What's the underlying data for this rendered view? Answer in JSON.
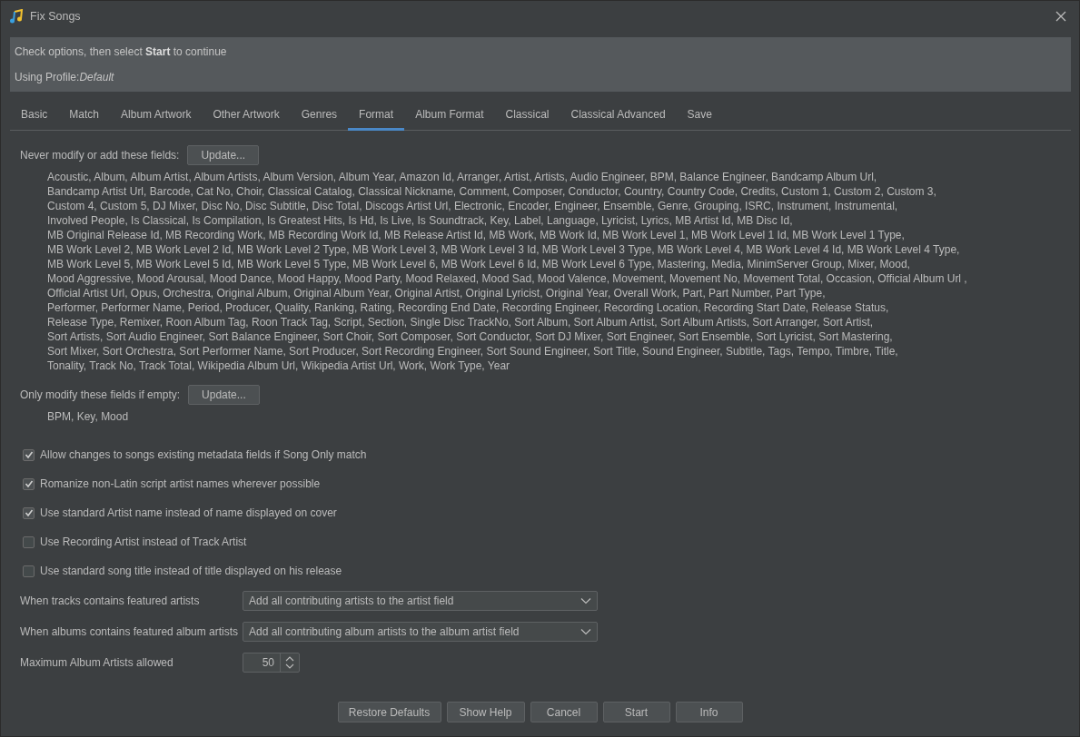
{
  "window": {
    "title": "Fix Songs"
  },
  "header": {
    "instruction": "Check options, then select **Start** to continue",
    "profile_label": "Using Profile:",
    "profile_name": "Default"
  },
  "tabs": [
    {
      "label": "Basic",
      "selected": false
    },
    {
      "label": "Match",
      "selected": false
    },
    {
      "label": "Album Artwork",
      "selected": false
    },
    {
      "label": "Other Artwork",
      "selected": false
    },
    {
      "label": "Genres",
      "selected": false
    },
    {
      "label": "Format",
      "selected": true
    },
    {
      "label": "Album Format",
      "selected": false
    },
    {
      "label": "Classical",
      "selected": false
    },
    {
      "label": "Classical Advanced",
      "selected": false
    },
    {
      "label": "Save",
      "selected": false
    }
  ],
  "never_modify": {
    "label": "Never modify or add these fields:",
    "button": "Update...",
    "lines": [
      "Acoustic, Album, Album Artist, Album Artists, Album Version, Album Year, Amazon Id, Arranger, Artist, Artists, Audio Engineer, BPM, Balance Engineer, Bandcamp Album Url,",
      "Bandcamp Artist Url, Barcode, Cat No, Choir, Classical Catalog, Classical Nickname, Comment, Composer, Conductor, Country, Country Code, Credits, Custom 1, Custom 2, Custom 3,",
      "Custom 4, Custom 5, DJ Mixer, Disc No, Disc Subtitle, Disc Total, Discogs Artist Url, Electronic, Encoder, Engineer, Ensemble, Genre, Grouping, ISRC, Instrument, Instrumental,",
      "Involved People, Is Classical, Is Compilation, Is Greatest Hits, Is Hd, Is Live, Is Soundtrack, Key, Label, Language, Lyricist, Lyrics, MB Artist Id, MB Disc Id,",
      "MB Original Release Id, MB Recording Work, MB Recording Work Id, MB Release Artist Id, MB Work, MB Work Id, MB Work Level 1, MB Work Level 1 Id, MB Work Level 1 Type,",
      "MB Work Level 2, MB Work Level 2 Id, MB Work Level 2 Type, MB Work Level 3, MB Work Level 3 Id, MB Work Level 3 Type, MB Work Level 4, MB Work Level 4 Id, MB Work Level 4 Type,",
      "MB Work Level 5, MB Work Level 5 Id, MB Work Level 5 Type, MB Work Level 6, MB Work Level 6 Id, MB Work Level 6 Type, Mastering, Media, MinimServer Group, Mixer, Mood,",
      "Mood Aggressive, Mood Arousal, Mood Dance, Mood Happy, Mood Party, Mood Relaxed, Mood Sad, Mood Valence, Movement, Movement No, Movement Total, Occasion, Official Album Url ,",
      "Official Artist Url, Opus, Orchestra, Original Album, Original Album Year, Original Artist, Original Lyricist, Original Year, Overall Work, Part, Part Number, Part Type,",
      "Performer, Performer Name, Period, Producer, Quality, Ranking, Rating, Recording End Date, Recording Engineer, Recording Location, Recording Start Date, Release Status,",
      "Release Type, Remixer, Roon Album Tag, Roon Track Tag, Script, Section, Single Disc TrackNo, Sort Album, Sort Album Artist, Sort Album Artists, Sort Arranger, Sort Artist,",
      "Sort Artists, Sort Audio Engineer, Sort Balance Engineer, Sort Choir, Sort Composer, Sort Conductor, Sort DJ Mixer, Sort Engineer, Sort Ensemble, Sort Lyricist, Sort Mastering,",
      "Sort Mixer, Sort Orchestra, Sort Performer Name, Sort Producer, Sort Recording Engineer, Sort Sound Engineer, Sort Title, Sound Engineer, Subtitle, Tags, Tempo, Timbre, Title,",
      "Tonality, Track No, Track Total, Wikipedia Album Url, Wikipedia Artist Url, Work, Work Type, Year"
    ]
  },
  "only_if_empty": {
    "label": "Only modify these fields if empty:",
    "button": "Update...",
    "lines": [
      "BPM, Key, Mood"
    ]
  },
  "checkboxes": [
    {
      "label": "Allow changes to songs existing metadata fields if Song Only match",
      "checked": true
    },
    {
      "label": "Romanize non-Latin script artist names wherever possible",
      "checked": true
    },
    {
      "label": "Use standard Artist name instead of name displayed on cover",
      "checked": true
    },
    {
      "label": "Use Recording Artist instead of Track Artist",
      "checked": false
    },
    {
      "label": "Use standard song title instead of title displayed on his release",
      "checked": false
    }
  ],
  "settings": [
    {
      "kind": "dropdown",
      "label": "When tracks contains featured artists",
      "value": "Add all contributing artists to the artist field"
    },
    {
      "kind": "dropdown",
      "label": "When albums contains featured album artists",
      "value": "Add all contributing album artists to the album artist field"
    },
    {
      "kind": "spinner",
      "label": "Maximum Album Artists allowed",
      "value": "50"
    }
  ],
  "buttons": [
    "Restore Defaults",
    "Show Help",
    "Cancel",
    "Start",
    "Info"
  ]
}
